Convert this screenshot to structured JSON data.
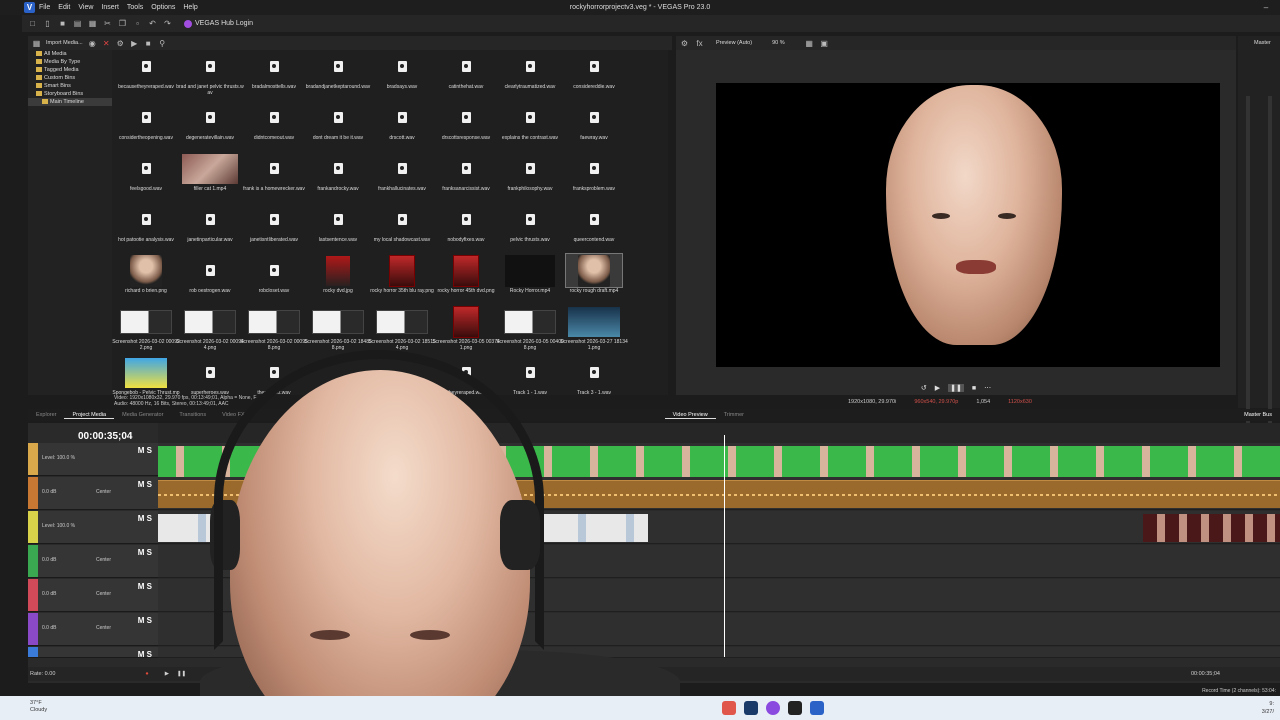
{
  "window": {
    "title": "rockyhorrorprojectv3.veg * - VEGAS Pro 23.0",
    "logo": "V",
    "menu": [
      "File",
      "Edit",
      "View",
      "Insert",
      "Tools",
      "Options",
      "Help"
    ],
    "controls": [
      "minimize-icon",
      "maximize-icon",
      "close-icon"
    ]
  },
  "toolbar": {
    "hub_label": "VEGAS Hub Login"
  },
  "project_media": {
    "import_label": "Import Media...",
    "tree": [
      "All Media",
      "Media By Type",
      "Tagged Media",
      "Custom Bins",
      "Smart Bins",
      "Storyboard Bins",
      "Main Timeline"
    ],
    "tree_selected": 6,
    "items": [
      {
        "label": "becausetheyreraped.wav",
        "kind": "audio"
      },
      {
        "label": "brad and janet pelvic thrusts.wav",
        "kind": "audio"
      },
      {
        "label": "bradalmosttells.wav",
        "kind": "audio"
      },
      {
        "label": "bradandjanetkeptaround.wav",
        "kind": "audio"
      },
      {
        "label": "bradsays.wav",
        "kind": "audio"
      },
      {
        "label": "catinthehat.wav",
        "kind": "audio"
      },
      {
        "label": "clearlytraumatized.wav",
        "kind": "audio"
      },
      {
        "label": "considereddie.wav",
        "kind": "audio"
      },
      {
        "label": "considertheopening.wav",
        "kind": "audio"
      },
      {
        "label": "degeneratevillain.wav",
        "kind": "audio"
      },
      {
        "label": "didntcomeout.wav",
        "kind": "audio"
      },
      {
        "label": "dont dream it be it.wav",
        "kind": "audio"
      },
      {
        "label": "drscott.wav",
        "kind": "audio"
      },
      {
        "label": "drscottsresponse.wav",
        "kind": "audio"
      },
      {
        "label": "explains the contrast.wav",
        "kind": "audio"
      },
      {
        "label": "faewray.wav",
        "kind": "audio"
      },
      {
        "label": "feelsgood.wav",
        "kind": "audio"
      },
      {
        "label": "filler cat 1.mp4",
        "kind": "cat"
      },
      {
        "label": "frank is a homewrecker.wav",
        "kind": "audio"
      },
      {
        "label": "frankandrocky.wav",
        "kind": "audio"
      },
      {
        "label": "frankhallucinates.wav",
        "kind": "audio"
      },
      {
        "label": "franksanarcissist.wav",
        "kind": "audio"
      },
      {
        "label": "frankphilosophy.wav",
        "kind": "audio"
      },
      {
        "label": "franksproblem.wav",
        "kind": "audio"
      },
      {
        "label": "hot patootie analysis.wav",
        "kind": "audio"
      },
      {
        "label": "janetinparticular.wav",
        "kind": "audio"
      },
      {
        "label": "janetisntliberated.wav",
        "kind": "audio"
      },
      {
        "label": "lastsentence.wav",
        "kind": "audio"
      },
      {
        "label": "my local shadowcast.wav",
        "kind": "audio"
      },
      {
        "label": "nobodyfixes.wav",
        "kind": "audio"
      },
      {
        "label": "pelvic thrusts.wav",
        "kind": "audio"
      },
      {
        "label": "queercontend.wav",
        "kind": "audio"
      },
      {
        "label": "richard o brien.png",
        "kind": "face"
      },
      {
        "label": "rob oestrogen.wav",
        "kind": "audio"
      },
      {
        "label": "robcloset.wav",
        "kind": "audio"
      },
      {
        "label": "rocky dvd.jpg",
        "kind": "dvd"
      },
      {
        "label": "rocky horror 35th blu ray.png",
        "kind": "poster"
      },
      {
        "label": "rocky horror 45th dvd.png",
        "kind": "poster"
      },
      {
        "label": "Rocky Horror.mp4",
        "kind": "black"
      },
      {
        "label": "rocky rough draft.mp4",
        "kind": "face",
        "selected": true
      },
      {
        "label": "Screenshot 2026-03-02 000922.png",
        "kind": "screen"
      },
      {
        "label": "Screenshot 2026-03-02 000944.png",
        "kind": "screen"
      },
      {
        "label": "Screenshot 2026-03-02 000958.png",
        "kind": "screen"
      },
      {
        "label": "Screenshot 2026-03-02 184858.png",
        "kind": "screen"
      },
      {
        "label": "Screenshot 2026-03-02 185154.png",
        "kind": "screen"
      },
      {
        "label": "Screenshot 2026-03-05 003741.png",
        "kind": "poster"
      },
      {
        "label": "Screenshot 2026-03-05 004008.png",
        "kind": "screen"
      },
      {
        "label": "Screenshot 2026-03-27 181341.png",
        "kind": "stage"
      },
      {
        "label": "Spongebob - Pelvic Thrust.mp4",
        "kind": "sponge"
      },
      {
        "label": "superheroes.wav",
        "kind": "audio"
      },
      {
        "label": "thesubtext.wav",
        "kind": "audio"
      },
      {
        "label": "",
        "kind": "none"
      },
      {
        "label": "",
        "kind": "none"
      },
      {
        "label": "theyreraped.wav",
        "kind": "audio"
      },
      {
        "label": "Track 1 - 1.wav",
        "kind": "audio"
      },
      {
        "label": "Track 3 - 1.wav",
        "kind": "audio"
      }
    ],
    "info_line1": "Video: 1920x1080x32, 29.970 fps, 00:13:49;01, Alpha = None, F",
    "info_line2": "Audio: 48000 Hz, 16 Bits, Stereo, 00:13:49;01, AAC"
  },
  "tabs": [
    "Explorer",
    "Project Media",
    "Media Generator",
    "Transitions",
    "Video FX"
  ],
  "active_tab": "Project Media",
  "preview": {
    "mode": "Preview (Auto)",
    "zoom": "90 %",
    "tabs": [
      "Video Preview",
      "Trimmer"
    ],
    "active_tab": "Video Preview",
    "project_res": "1920x1080, 29.970i",
    "preview_res": "960x540, 29.970p",
    "frame": "1,054",
    "display": "1120x630"
  },
  "master": {
    "label": "Master",
    "bus_label": "Master Bus"
  },
  "timeline": {
    "time": "00:00:35;04",
    "tracks": [
      {
        "type": "video",
        "level": "Level: 100.0 %",
        "color": "#d9a84a"
      },
      {
        "type": "audio",
        "db": "0.0 dB",
        "pan": "Center",
        "color": "#c87832"
      },
      {
        "type": "video",
        "level": "Level: 100.0 %",
        "color": "#d8d14a"
      },
      {
        "type": "audio",
        "db": "0.0 dB",
        "pan": "Center",
        "color": "#3aa850"
      },
      {
        "type": "audio",
        "db": "0.0 dB",
        "pan": "Center",
        "color": "#d04a5a"
      },
      {
        "type": "audio",
        "db": "0.0 dB",
        "pan": "Center",
        "color": "#8a4ac8"
      },
      {
        "type": "audio",
        "db": "",
        "pan": "",
        "color": "#3a7ad8"
      }
    ],
    "rate": "Rate: 0.00",
    "end_time": "00:00:35;04",
    "record_time": "Record Time (2 channels): 53:04:"
  },
  "taskbar": {
    "temp": "37°F",
    "weather": "Cloudy",
    "time": "9:",
    "date": "3/27/"
  }
}
